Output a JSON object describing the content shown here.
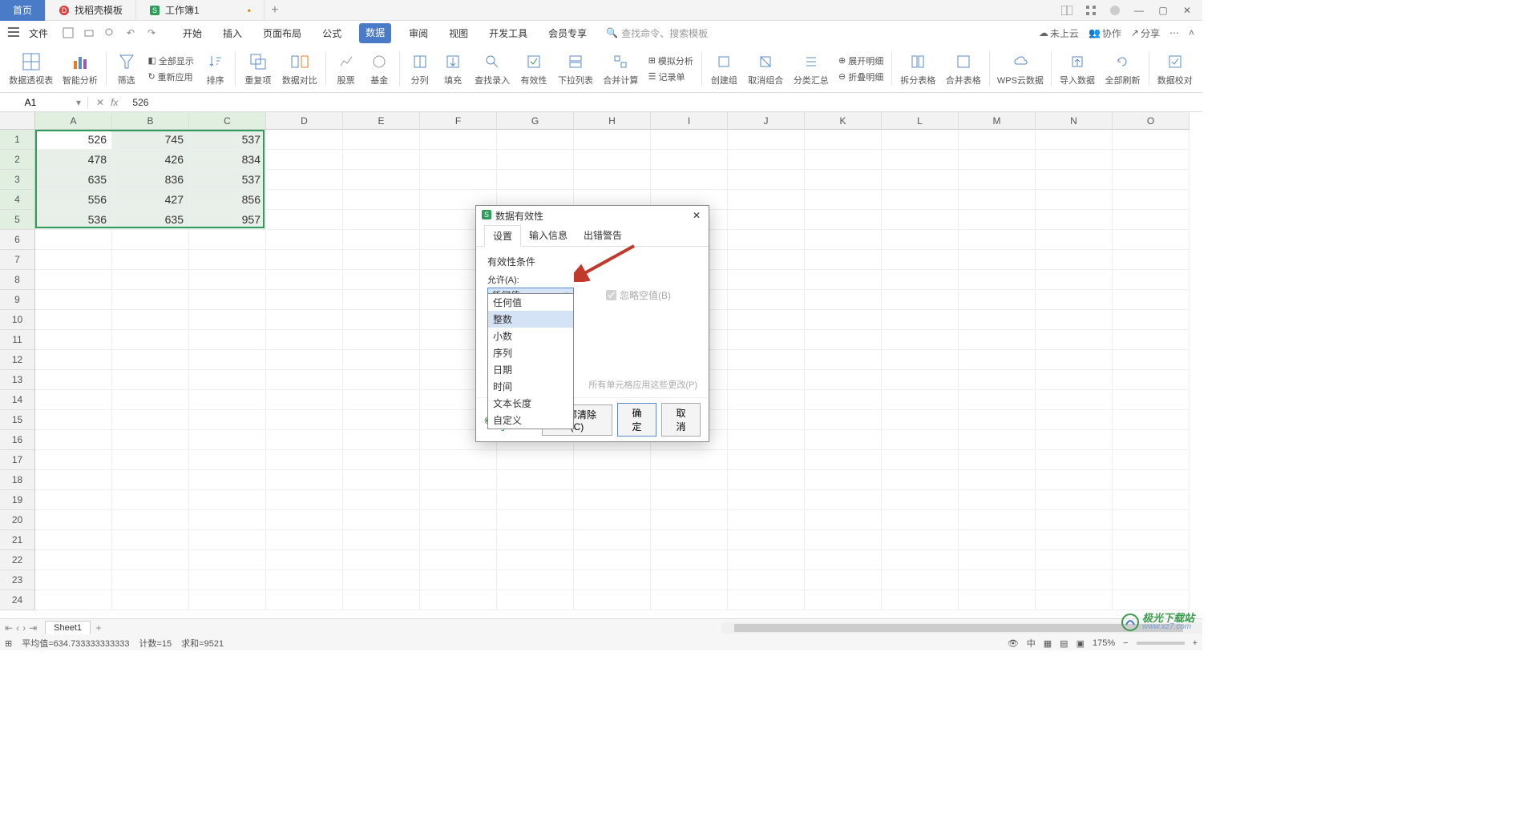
{
  "tabs": {
    "home": "首页",
    "template": "找稻壳模板",
    "workbook": "工作簿1",
    "dirty": "•"
  },
  "menu": {
    "file": "文件",
    "items": [
      "开始",
      "插入",
      "页面布局",
      "公式",
      "数据",
      "审阅",
      "视图",
      "开发工具",
      "会员专享"
    ],
    "search_placeholder": "查找命令、搜索模板",
    "right": {
      "cloud": "未上云",
      "collab": "协作",
      "share": "分享"
    }
  },
  "ribbon": {
    "pivot": "数据透视表",
    "smart": "智能分析",
    "filter": "筛选",
    "show_all": "全部显示",
    "reapply": "重新应用",
    "sort": "排序",
    "dupes": "重复项",
    "compare": "数据对比",
    "stock": "股票",
    "fund": "基金",
    "split": "分列",
    "fill": "填充",
    "lookup": "查找录入",
    "validate": "有效性",
    "dropdown": "下拉列表",
    "consol": "合并计算",
    "simul": "模拟分析",
    "record": "记录单",
    "group": "创建组",
    "ungroup": "取消组合",
    "subtotal": "分类汇总",
    "expand": "展开明细",
    "collapse": "折叠明细",
    "split_tbl": "拆分表格",
    "merge_tbl": "合并表格",
    "wps_cloud": "WPS云数据",
    "import": "导入数据",
    "refresh": "全部刷新",
    "proof": "数据校对"
  },
  "name_box": "A1",
  "fx_value": "526",
  "columns": [
    "A",
    "B",
    "C",
    "D",
    "E",
    "F",
    "G",
    "H",
    "I",
    "J",
    "K",
    "L",
    "M",
    "N",
    "O"
  ],
  "rows": 24,
  "data": [
    [
      "526",
      "745",
      "537"
    ],
    [
      "478",
      "426",
      "834"
    ],
    [
      "635",
      "836",
      "537"
    ],
    [
      "556",
      "427",
      "856"
    ],
    [
      "536",
      "635",
      "957"
    ]
  ],
  "sel_cols": 3,
  "sel_rows": 5,
  "sheet": {
    "name": "Sheet1"
  },
  "status": {
    "avg_label": "平均值=",
    "avg": "634.733333333333",
    "count_label": "计数=",
    "count": "15",
    "sum_label": "求和=",
    "sum": "9521",
    "zoom": "175%"
  },
  "dialog": {
    "title": "数据有效性",
    "tabs": [
      "设置",
      "输入信息",
      "出错警告"
    ],
    "cond_label": "有效性条件",
    "allow_label": "允许(A):",
    "allow_value": "任何值",
    "ignore_blank": "忽略空值(B)",
    "options": [
      "任何值",
      "整数",
      "小数",
      "序列",
      "日期",
      "时间",
      "文本长度",
      "自定义"
    ],
    "apply_note": "所有单元格应用这些更改(P)",
    "help": "操作技巧",
    "clear": "全部清除(C)",
    "ok": "确定",
    "cancel": "取消"
  },
  "watermark": {
    "text": "极光下载站",
    "url": "www.xz7.com"
  }
}
